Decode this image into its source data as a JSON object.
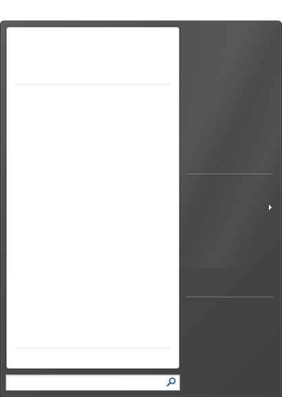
{
  "start_menu": {
    "pinned_items": [],
    "recent_items": [],
    "all_programs_label": "",
    "search": {
      "value": "",
      "placeholder": "",
      "icon": "magnifier-icon"
    },
    "right_column": {
      "upper_items": [],
      "places_item_label": "",
      "places_item_has_submenu": true,
      "power_items": []
    }
  },
  "colors": {
    "frame": "#474747",
    "left_pane": "#ffffff",
    "divider_light": "#e4e6e8",
    "search_icon": "#1f5fa8"
  }
}
